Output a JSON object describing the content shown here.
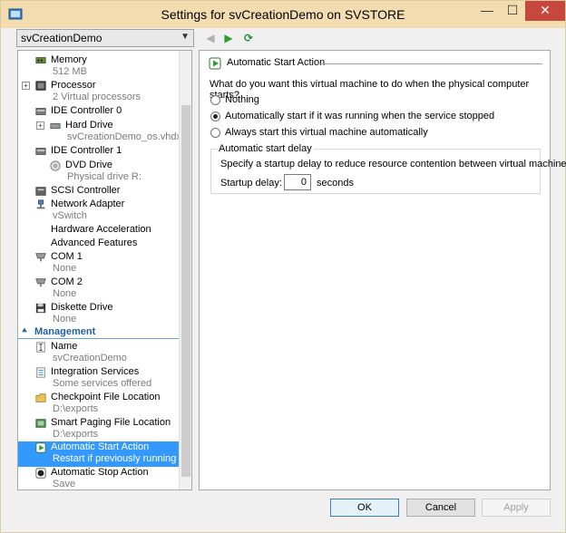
{
  "window": {
    "title": "Settings for svCreationDemo on SVSTORE",
    "min": "—",
    "max": "☐",
    "close": "✕"
  },
  "vm_select": {
    "value": "svCreationDemo"
  },
  "tree": {
    "items": [
      {
        "name": "Memory",
        "sub": "512 MB"
      },
      {
        "name": "Processor",
        "sub": "2 Virtual processors"
      },
      {
        "name": "IDE Controller 0",
        "sub": ""
      },
      {
        "name": "Hard Drive",
        "sub": "svCreationDemo_os.vhdx"
      },
      {
        "name": "IDE Controller 1",
        "sub": ""
      },
      {
        "name": "DVD Drive",
        "sub": "Physical drive R:"
      },
      {
        "name": "SCSI Controller",
        "sub": ""
      },
      {
        "name": "Network Adapter",
        "sub": "vSwitch"
      },
      {
        "name": "Hardware Acceleration",
        "sub": ""
      },
      {
        "name": "Advanced Features",
        "sub": ""
      },
      {
        "name": "COM 1",
        "sub": "None"
      },
      {
        "name": "COM 2",
        "sub": "None"
      },
      {
        "name": "Diskette Drive",
        "sub": "None"
      }
    ],
    "management_label": "Management",
    "mgmt": [
      {
        "name": "Name",
        "sub": "svCreationDemo"
      },
      {
        "name": "Integration Services",
        "sub": "Some services offered"
      },
      {
        "name": "Checkpoint File Location",
        "sub": "D:\\exports"
      },
      {
        "name": "Smart Paging File Location",
        "sub": "D:\\exports"
      },
      {
        "name": "Automatic Start Action",
        "sub": "Restart if previously running"
      },
      {
        "name": "Automatic Stop Action",
        "sub": "Save"
      }
    ]
  },
  "panel": {
    "section_title": "Automatic Start Action",
    "question": "What do you want this virtual machine to do when the physical computer starts?",
    "options": [
      {
        "label": "Nothing",
        "checked": false
      },
      {
        "label": "Automatically start if it was running when the service stopped",
        "checked": true
      },
      {
        "label": "Always start this virtual machine automatically",
        "checked": false
      }
    ],
    "delay_group_title": "Automatic start delay",
    "delay_desc": "Specify a startup delay to reduce resource contention between virtual machines.",
    "delay_label": "Startup delay:",
    "delay_value": "0",
    "delay_unit": "seconds"
  },
  "buttons": {
    "ok": "OK",
    "cancel": "Cancel",
    "apply": "Apply"
  }
}
